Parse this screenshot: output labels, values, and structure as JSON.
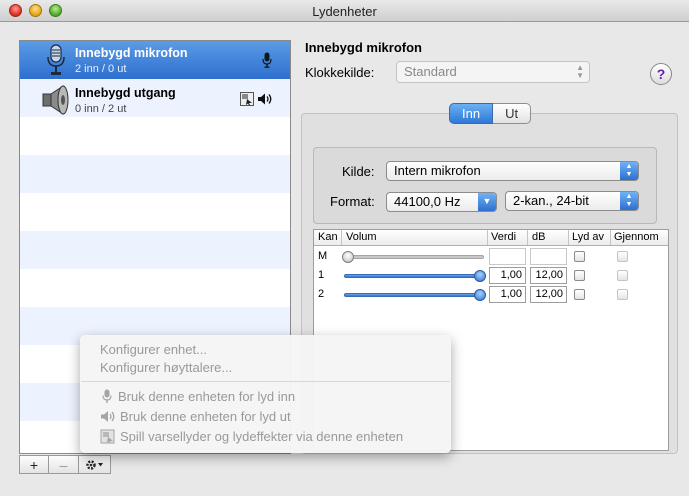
{
  "window": {
    "title": "Lydenheter"
  },
  "devices": [
    {
      "name": "Innebygd mikrofon",
      "io": "2 inn / 0 ut",
      "selected": true,
      "icon": "microphone-icon",
      "right_icons": [
        "microphone-icon"
      ]
    },
    {
      "name": "Innebygd utgang",
      "io": "0 inn / 2 ut",
      "selected": false,
      "icon": "speaker-icon",
      "right_icons": [
        "alert-sound-icon",
        "speaker-icon"
      ]
    }
  ],
  "list_buttons": {
    "add": "+",
    "remove": "–",
    "action": "gear-icon"
  },
  "context_menu": {
    "items": [
      {
        "label": "Konfigurer enhet...",
        "enabled": false
      },
      {
        "label": "Konfigurer høyttalere...",
        "enabled": false
      },
      {
        "label": "Bruk denne enheten for lyd inn",
        "enabled": false,
        "icon": "microphone-icon"
      },
      {
        "label": "Bruk denne enheten for lyd ut",
        "enabled": false,
        "icon": "speaker-icon"
      },
      {
        "label": "Spill varsellyder og lydeffekter via denne enheten",
        "enabled": false,
        "icon": "alert-sound-icon"
      }
    ]
  },
  "detail": {
    "title": "Innebygd mikrofon",
    "clock_label": "Klokkekilde:",
    "clock_value": "Standard",
    "help": "?",
    "tabs": {
      "inn": "Inn",
      "ut": "Ut",
      "active": "Inn"
    },
    "source_label": "Kilde:",
    "source_value": "Intern mikrofon",
    "format_label": "Format:",
    "format_rate": "44100,0 Hz",
    "format_bits": "2-kan., 24-bit"
  },
  "channel_table": {
    "headers": {
      "kan": "Kan",
      "volum": "Volum",
      "verdi": "Verdi",
      "db": "dB",
      "mute": "Lyd av",
      "thru": "Gjennom"
    },
    "rows": [
      {
        "ch": "M",
        "volume": 0.0,
        "verdi": "",
        "db": "",
        "enabled": false
      },
      {
        "ch": "1",
        "volume": 1.0,
        "verdi": "1,00",
        "db": "12,00",
        "enabled": true
      },
      {
        "ch": "2",
        "volume": 1.0,
        "verdi": "1,00",
        "db": "12,00",
        "enabled": true
      }
    ]
  },
  "colors": {
    "selection": "#2e6fcf",
    "accent": "#3a7fdc"
  }
}
